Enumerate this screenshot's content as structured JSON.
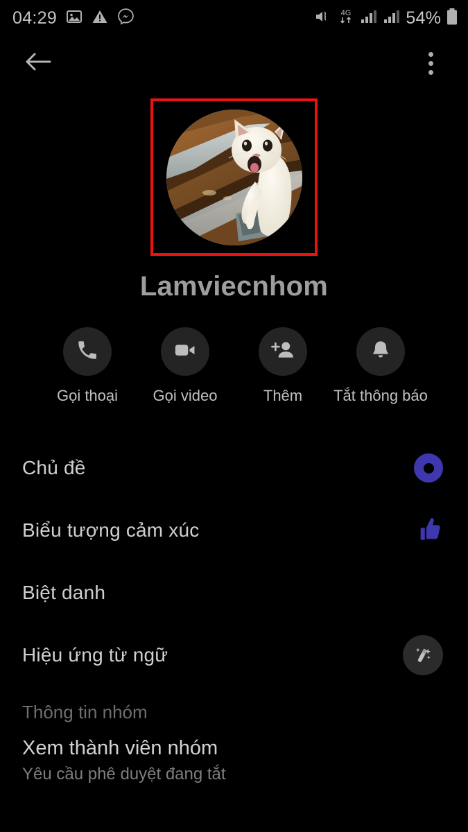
{
  "status_bar": {
    "time": "04:29",
    "battery_percent": "54%",
    "network_type": "4G",
    "left_icons": [
      "image-icon",
      "warning-icon",
      "messenger-icon"
    ],
    "right_icons": [
      "mute-vibrate-icon",
      "mobile-data-icon",
      "signal-bars-sim1-icon",
      "signal-bars-sim2-icon",
      "battery-icon"
    ]
  },
  "nav_bar": {
    "back_icon": "back-arrow-icon",
    "overflow_icon": "more-options-icon"
  },
  "profile": {
    "avatar_alt": "group-avatar-cat-photo",
    "name": "Lamviecnhom",
    "highlight_color": "#ee1111"
  },
  "actions": [
    {
      "label": "Gọi thoại",
      "icon": "phone-icon"
    },
    {
      "label": "Gọi video",
      "icon": "video-camera-icon"
    },
    {
      "label": "Thêm",
      "icon": "add-person-icon"
    },
    {
      "label": "Tắt thông báo",
      "icon": "bell-icon"
    }
  ],
  "menu": {
    "theme": {
      "label": "Chủ đề",
      "icon": "theme-color-circle-icon",
      "accent": "#3f37ae"
    },
    "emoji": {
      "label": "Biểu tượng cảm xúc",
      "icon": "thumbs-up-icon",
      "accent": "#3f37ae"
    },
    "nickname": {
      "label": "Biệt danh"
    },
    "word_effect": {
      "label": "Hiệu ứng từ ngữ",
      "icon": "magic-wand-icon"
    }
  },
  "group_section": {
    "header": "Thông tin nhóm",
    "members": {
      "title": "Xem thành viên nhóm",
      "subtitle": "Yêu cầu phê duyệt đang tắt"
    }
  }
}
